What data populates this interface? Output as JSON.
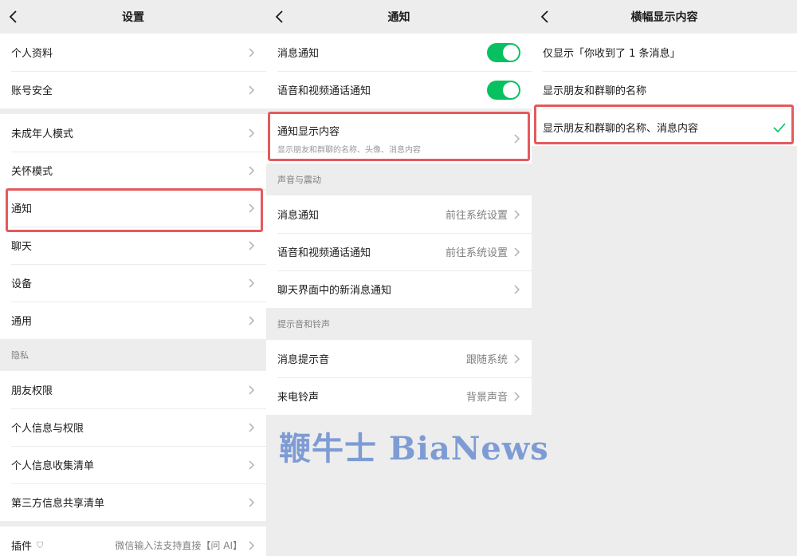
{
  "panel1": {
    "title": "设置",
    "group1": [
      "个人资料",
      "账号安全"
    ],
    "group2": [
      "未成年人模式",
      "关怀模式",
      "通知",
      "聊天",
      "设备",
      "通用"
    ],
    "privacy_title": "隐私",
    "group3": [
      "朋友权限",
      "个人信息与权限",
      "个人信息收集清单",
      "第三方信息共享清单"
    ],
    "plugin_label": "插件",
    "plugin_value": "微信输入法支持直接【问 AI】"
  },
  "panel2": {
    "title": "通知",
    "toggle1_label": "消息通知",
    "toggle1_on": true,
    "toggle2_label": "语音和视频通话通知",
    "toggle2_on": true,
    "display_label": "通知显示内容",
    "display_sub": "显示朋友和群聊的名称、头像、消息内容",
    "sound_title": "声音与震动",
    "sound_rows": [
      {
        "label": "消息通知",
        "value": "前往系统设置"
      },
      {
        "label": "语音和视频通话通知",
        "value": "前往系统设置"
      },
      {
        "label": "聊天界面中的新消息通知",
        "value": ""
      }
    ],
    "ring_title": "提示音和铃声",
    "ring_rows": [
      {
        "label": "消息提示音",
        "value": "跟随系统"
      },
      {
        "label": "来电铃声",
        "value": "背景声音"
      }
    ]
  },
  "panel3": {
    "title": "横幅显示内容",
    "options": [
      "仅显示「你收到了 1 条消息」",
      "显示朋友和群聊的名称",
      "显示朋友和群聊的名称、消息内容"
    ],
    "selected_index": 2
  },
  "watermark": "鞭牛士 BiaNews",
  "colors": {
    "accent": "#07c160",
    "highlight": "#e35a5e",
    "watermark": "#6b8ed0"
  },
  "icons": {
    "back": "chevron-left-icon",
    "more": "chevron-right-icon",
    "check": "check-icon",
    "plugin": "shield-icon"
  }
}
